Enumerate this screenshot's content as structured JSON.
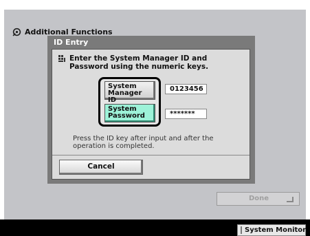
{
  "header": {
    "title": "Additional Functions",
    "icon": "wrench-gear-icon"
  },
  "dialog": {
    "title": "ID Entry",
    "instruction": "Enter the System Manager ID and Password using the numeric keys.",
    "instruction_icon": "keypad-icon",
    "manager_id_label_line1": "System",
    "manager_id_label_line2": "Manager ID",
    "manager_id_value": "0123456",
    "password_label_line1": "System",
    "password_label_line2": "Password",
    "password_value": "*******",
    "note": "Press the ID key after input and after the operation is completed.",
    "cancel_label": "Cancel",
    "selected_field_color": "#9df2d8"
  },
  "footer": {
    "done_label": "Done",
    "system_monitor_label": "System Monitor"
  }
}
